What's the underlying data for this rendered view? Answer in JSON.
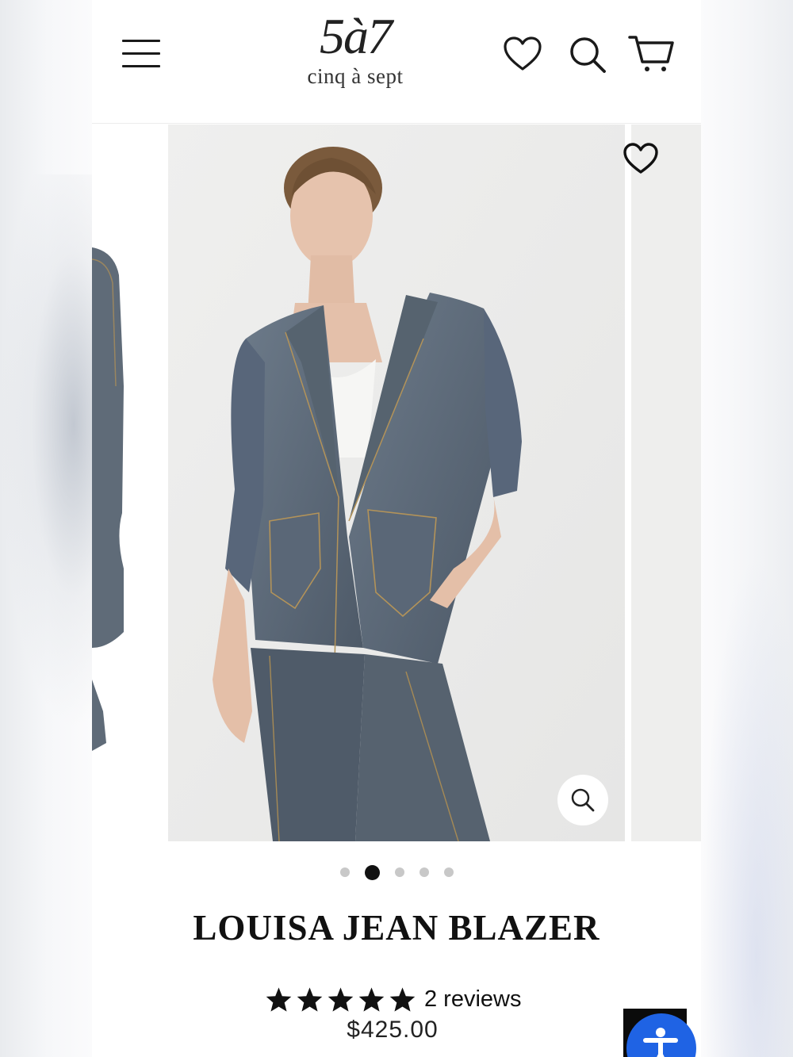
{
  "header": {
    "logo_mark": "5à7",
    "logo_sub": "cinq à sept",
    "menu_icon": "hamburger-menu-icon",
    "wishlist_icon": "heart-icon",
    "search_icon": "search-icon",
    "cart_icon": "cart-icon"
  },
  "gallery": {
    "slide_count": 5,
    "active_slide": 2,
    "favorite_icon": "heart-outline-icon",
    "zoom_icon": "magnifier-icon"
  },
  "product": {
    "title": "LOUISA JEAN BLAZER",
    "rating": 5,
    "reviews_label": "2 reviews",
    "price": "$425.00"
  },
  "accessibility": {
    "icon": "accessibility-person-icon",
    "color": "#1f63e4"
  }
}
